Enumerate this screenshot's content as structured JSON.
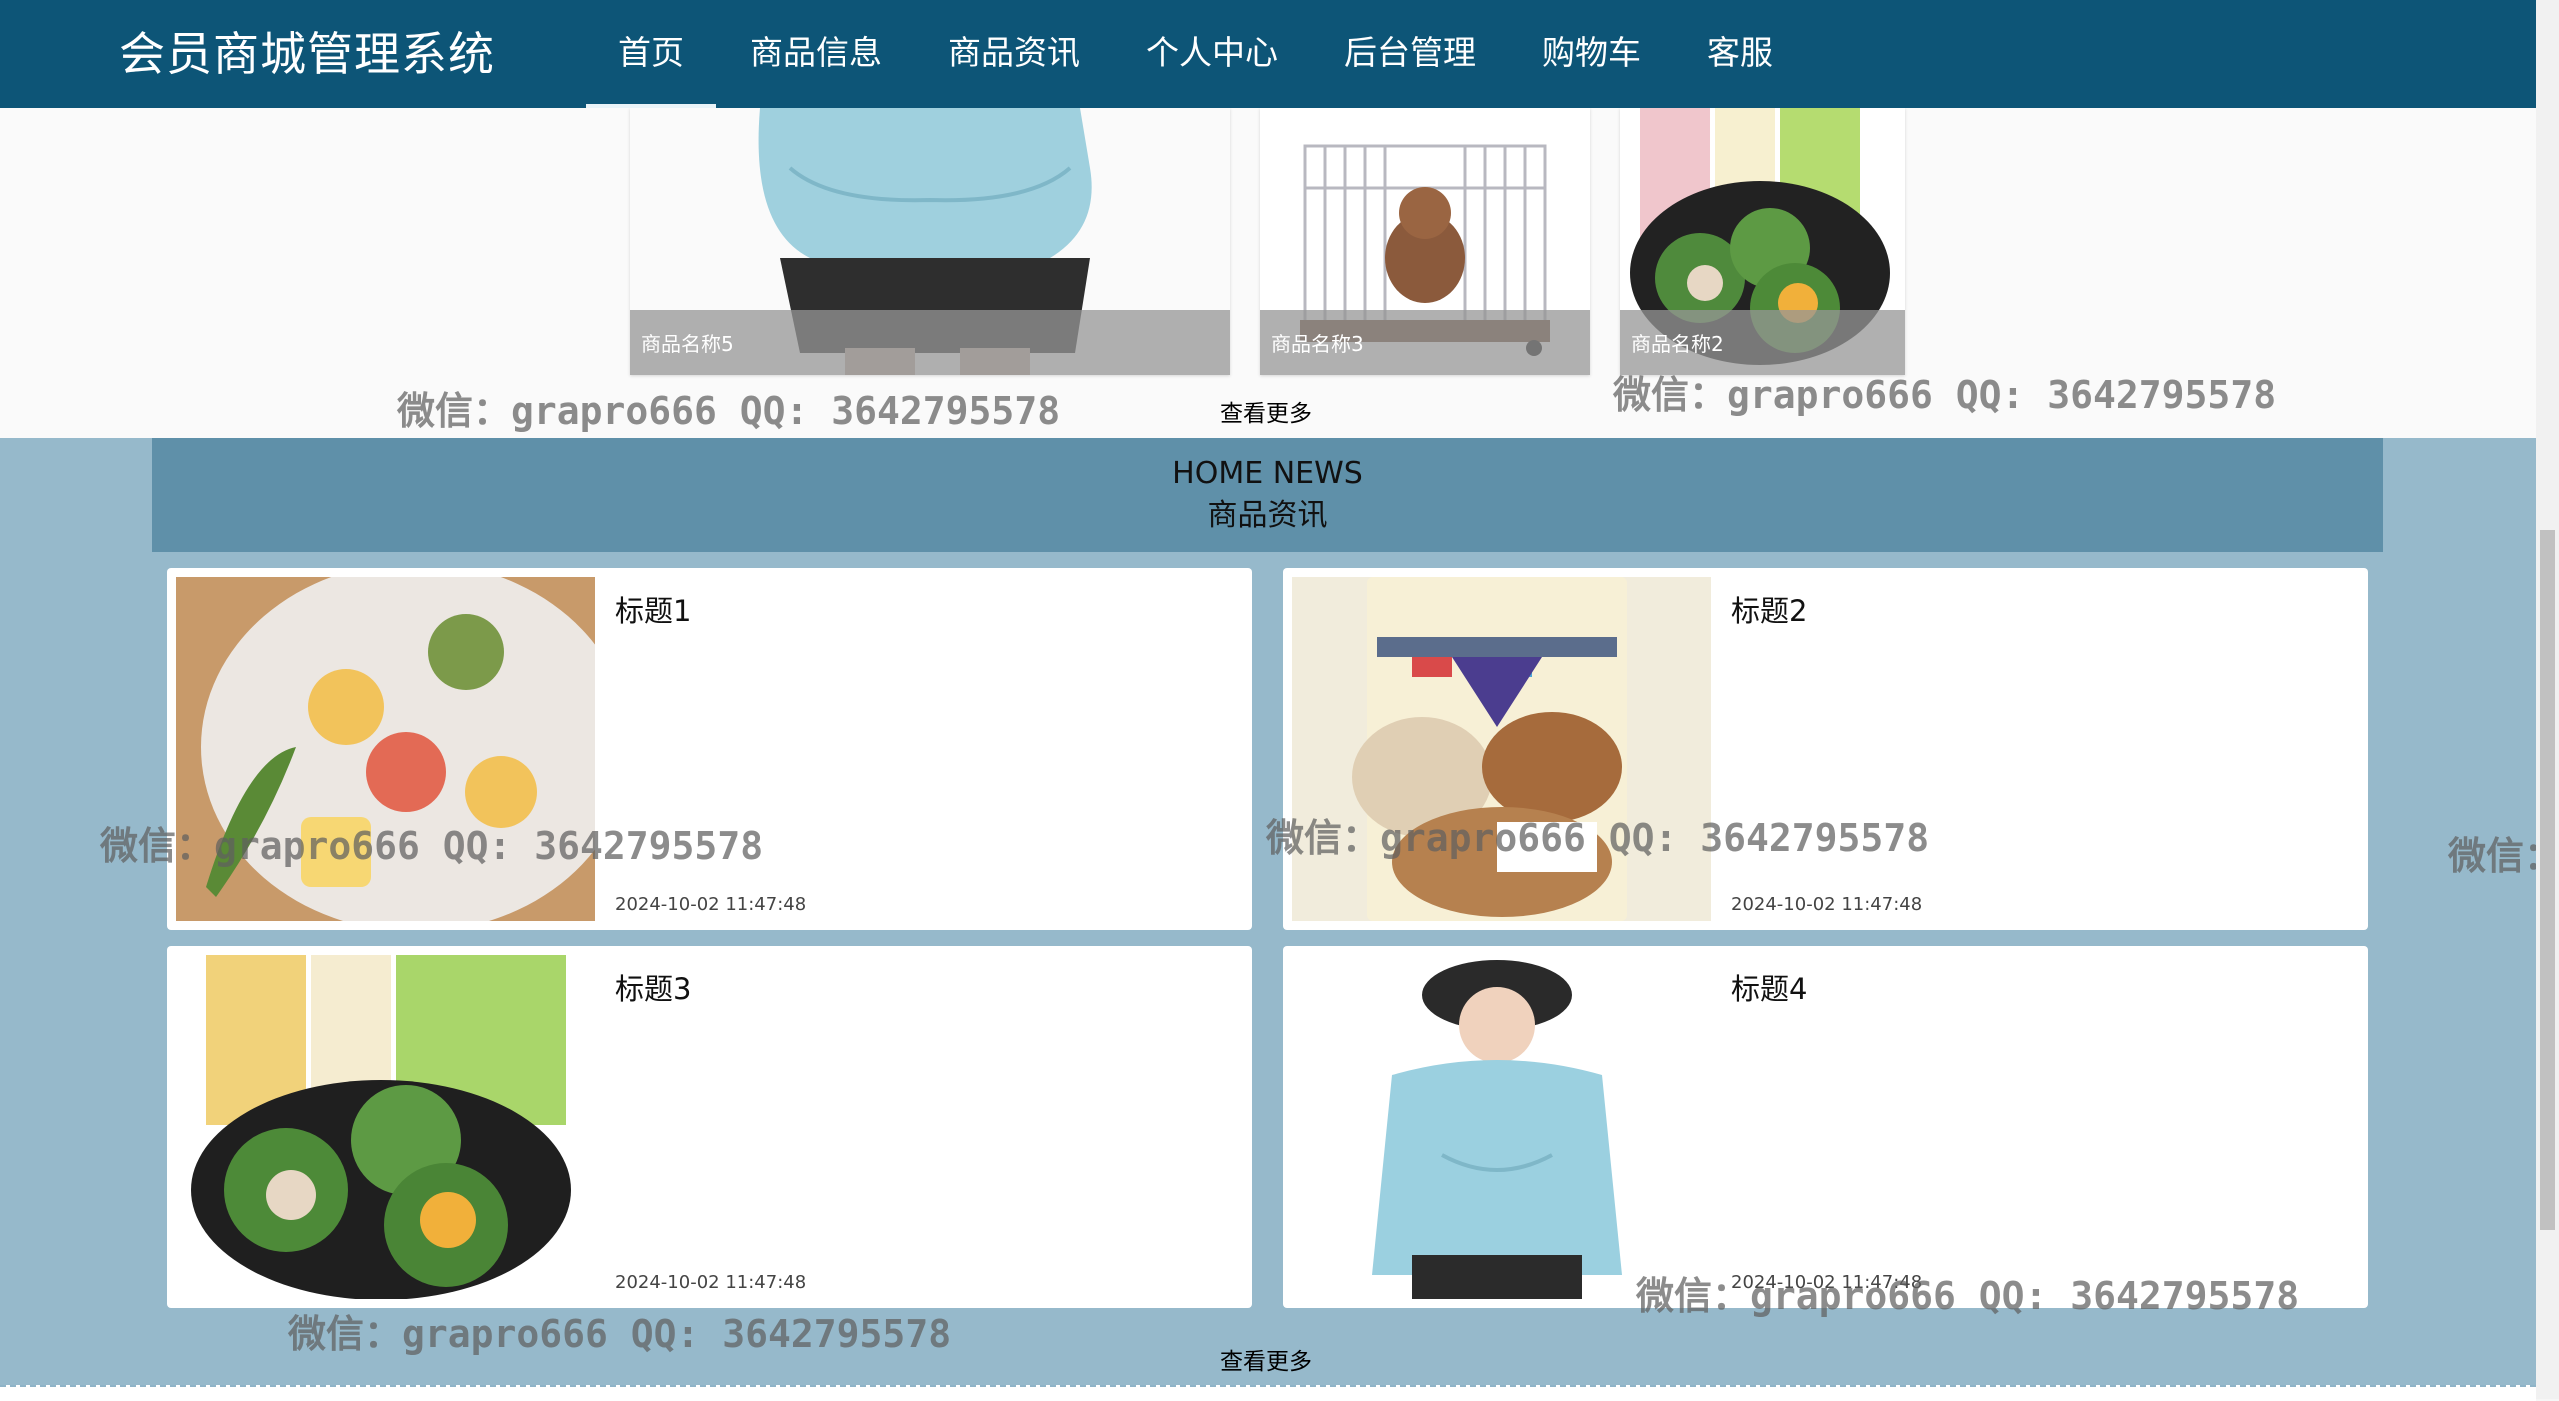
{
  "app": {
    "title": "会员商城管理系统"
  },
  "nav": {
    "items": [
      {
        "label": "首页",
        "active": true
      },
      {
        "label": "商品信息"
      },
      {
        "label": "商品资讯"
      },
      {
        "label": "个人中心"
      },
      {
        "label": "后台管理"
      },
      {
        "label": "购物车"
      },
      {
        "label": "客服"
      }
    ]
  },
  "products": {
    "items": [
      {
        "name": "商品名称5"
      },
      {
        "name": "商品名称3"
      },
      {
        "name": "商品名称2"
      }
    ],
    "more_label": "查看更多"
  },
  "news": {
    "header_en": "HOME NEWS",
    "header_cn": "商品资讯",
    "items": [
      {
        "title": "标题1",
        "date": "2024-10-02 11:47:48"
      },
      {
        "title": "标题2",
        "date": "2024-10-02 11:47:48"
      },
      {
        "title": "标题3",
        "date": "2024-10-02 11:47:48"
      },
      {
        "title": "标题4",
        "date": "2024-10-02 11:47:48"
      }
    ],
    "more_label": "查看更多"
  },
  "watermark": {
    "text": "微信：grapro666 QQ: 3642795578",
    "short": "微信："
  },
  "colors": {
    "nav_bg": "#0d5577",
    "news_bg": "#96b9cb",
    "news_header_bg": "#5f90a9"
  }
}
